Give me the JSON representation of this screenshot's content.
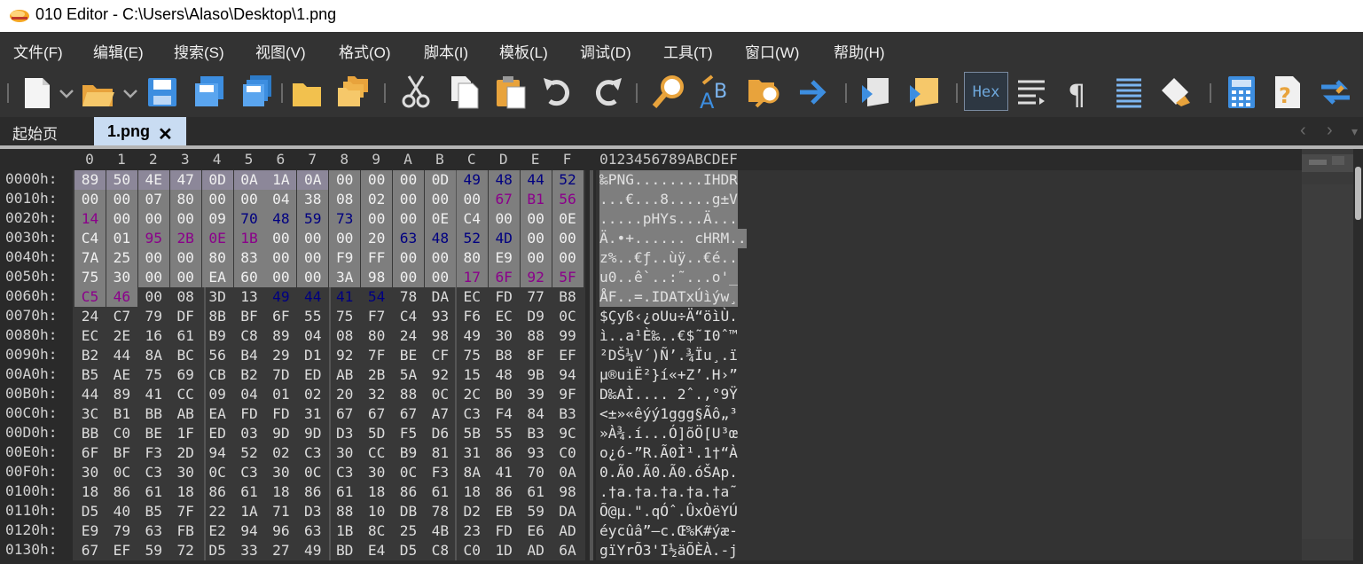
{
  "window": {
    "title": "010 Editor - C:\\Users\\Alaso\\Desktop\\1.png"
  },
  "menu": [
    "文件(F)",
    "编辑(E)",
    "搜索(S)",
    "视图(V)",
    "格式(O)",
    "脚本(I)",
    "模板(L)",
    "调试(D)",
    "工具(T)",
    "窗口(W)",
    "帮助(H)"
  ],
  "toolbar": {
    "hex_label": "Hex",
    "buttons": [
      "new-file-icon",
      "open-folder-icon",
      "save-icon",
      "save-as-icon",
      "save-all-icon",
      "open-folder2-icon",
      "folders-icon",
      "cut-icon",
      "copy-icon",
      "paste-icon",
      "undo-icon",
      "redo-icon",
      "find-icon",
      "replace-icon",
      "find-in-files-icon",
      "goto-icon",
      "run-script-icon",
      "run-template-icon",
      "hex-mode-button",
      "linewrap-icon",
      "pilcrow-icon",
      "columns-icon",
      "highlight-icon",
      "calculator-icon",
      "help-icon",
      "compare-icon"
    ]
  },
  "tabs": {
    "start": "起始页",
    "file": "1.png",
    "close": "✕"
  },
  "hex": {
    "columns": [
      "0",
      "1",
      "2",
      "3",
      "4",
      "5",
      "6",
      "7",
      "8",
      "9",
      "A",
      "B",
      "C",
      "D",
      "E",
      "F"
    ],
    "ascii_header": "0123456789ABCDEF",
    "rows": [
      {
        "addr": "0000h:",
        "bytes": [
          "89",
          "50",
          "4E",
          "47",
          "0D",
          "0A",
          "1A",
          "0A",
          "00",
          "00",
          "00",
          "0D",
          "49",
          "48",
          "44",
          "52"
        ],
        "ascii": "‰PNG........IHDR"
      },
      {
        "addr": "0010h:",
        "bytes": [
          "00",
          "00",
          "07",
          "80",
          "00",
          "00",
          "04",
          "38",
          "08",
          "02",
          "00",
          "00",
          "00",
          "67",
          "B1",
          "56"
        ],
        "ascii": "...€...8.....g±V"
      },
      {
        "addr": "0020h:",
        "bytes": [
          "14",
          "00",
          "00",
          "00",
          "09",
          "70",
          "48",
          "59",
          "73",
          "00",
          "00",
          "0E",
          "C4",
          "00",
          "00",
          "0E"
        ],
        "ascii": ".....pHYs...Ä..."
      },
      {
        "addr": "0030h:",
        "bytes": [
          "C4",
          "01",
          "95",
          "2B",
          "0E",
          "1B",
          "00",
          "00",
          "00",
          "20",
          "63",
          "48",
          "52",
          "4D",
          "00",
          "00"
        ],
        "ascii": "Ä.•+...... cHRM.."
      },
      {
        "addr": "0040h:",
        "bytes": [
          "7A",
          "25",
          "00",
          "00",
          "80",
          "83",
          "00",
          "00",
          "F9",
          "FF",
          "00",
          "00",
          "80",
          "E9",
          "00",
          "00"
        ],
        "ascii": "z%..€ƒ..ùÿ..€é.."
      },
      {
        "addr": "0050h:",
        "bytes": [
          "75",
          "30",
          "00",
          "00",
          "EA",
          "60",
          "00",
          "00",
          "3A",
          "98",
          "00",
          "00",
          "17",
          "6F",
          "92",
          "5F"
        ],
        "ascii": "u0..ê`..:˜...o'_"
      },
      {
        "addr": "0060h:",
        "bytes": [
          "C5",
          "46",
          "00",
          "08",
          "3D",
          "13",
          "49",
          "44",
          "41",
          "54",
          "78",
          "DA",
          "EC",
          "FD",
          "77",
          "B8"
        ],
        "ascii": "ÅF..=.IDATxÚìýw¸"
      },
      {
        "addr": "0070h:",
        "bytes": [
          "24",
          "C7",
          "79",
          "DF",
          "8B",
          "BF",
          "6F",
          "55",
          "75",
          "F7",
          "C4",
          "93",
          "F6",
          "EC",
          "D9",
          "0C"
        ],
        "ascii": "$Çyß‹¿oUu÷Ä“öìÙ."
      },
      {
        "addr": "0080h:",
        "bytes": [
          "EC",
          "2E",
          "16",
          "61",
          "B9",
          "C8",
          "89",
          "04",
          "08",
          "80",
          "24",
          "98",
          "49",
          "30",
          "88",
          "99"
        ],
        "ascii": "ì..a¹È‰..€$˜I0ˆ™"
      },
      {
        "addr": "0090h:",
        "bytes": [
          "B2",
          "44",
          "8A",
          "BC",
          "56",
          "B4",
          "29",
          "D1",
          "92",
          "7F",
          "BE",
          "CF",
          "75",
          "B8",
          "8F",
          "EF"
        ],
        "ascii": "²DŠ¼V´)Ñ’.¾Ïu¸.ï"
      },
      {
        "addr": "00A0h:",
        "bytes": [
          "B5",
          "AE",
          "75",
          "69",
          "CB",
          "B2",
          "7D",
          "ED",
          "AB",
          "2B",
          "5A",
          "92",
          "15",
          "48",
          "9B",
          "94"
        ],
        "ascii": "µ®uiË²}í«+Z’.H›”"
      },
      {
        "addr": "00B0h:",
        "bytes": [
          "44",
          "89",
          "41",
          "CC",
          "09",
          "04",
          "01",
          "02",
          "20",
          "32",
          "88",
          "0C",
          "2C",
          "B0",
          "39",
          "9F"
        ],
        "ascii": "D‰AÌ.... 2ˆ.,°9Ÿ"
      },
      {
        "addr": "00C0h:",
        "bytes": [
          "3C",
          "B1",
          "BB",
          "AB",
          "EA",
          "FD",
          "FD",
          "31",
          "67",
          "67",
          "67",
          "A7",
          "C3",
          "F4",
          "84",
          "B3"
        ],
        "ascii": "<±»«êýý1ggg§Ãô„³"
      },
      {
        "addr": "00D0h:",
        "bytes": [
          "BB",
          "C0",
          "BE",
          "1F",
          "ED",
          "03",
          "9D",
          "9D",
          "D3",
          "5D",
          "F5",
          "D6",
          "5B",
          "55",
          "B3",
          "9C"
        ],
        "ascii": "»À¾.í...Ó]õÖ[U³œ"
      },
      {
        "addr": "00E0h:",
        "bytes": [
          "6F",
          "BF",
          "F3",
          "2D",
          "94",
          "52",
          "02",
          "C3",
          "30",
          "CC",
          "B9",
          "81",
          "31",
          "86",
          "93",
          "C0"
        ],
        "ascii": "o¿ó-”R.Ã0Ì¹.1†“À"
      },
      {
        "addr": "00F0h:",
        "bytes": [
          "30",
          "0C",
          "C3",
          "30",
          "0C",
          "C3",
          "30",
          "0C",
          "C3",
          "30",
          "0C",
          "F3",
          "8A",
          "41",
          "70",
          "0A"
        ],
        "ascii": "0.Ã0.Ã0.Ã0.óŠAp."
      },
      {
        "addr": "0100h:",
        "bytes": [
          "18",
          "86",
          "61",
          "18",
          "86",
          "61",
          "18",
          "86",
          "61",
          "18",
          "86",
          "61",
          "18",
          "86",
          "61",
          "98"
        ],
        "ascii": ".†a.†a.†a.†a.†a˜"
      },
      {
        "addr": "0110h:",
        "bytes": [
          "D5",
          "40",
          "B5",
          "7F",
          "22",
          "1A",
          "71",
          "D3",
          "88",
          "10",
          "DB",
          "78",
          "D2",
          "EB",
          "59",
          "DA"
        ],
        "ascii": "Õ@µ.\".qÓˆ.ÛxÒëYÚ"
      },
      {
        "addr": "0120h:",
        "bytes": [
          "E9",
          "79",
          "63",
          "FB",
          "E2",
          "94",
          "96",
          "63",
          "1B",
          "8C",
          "25",
          "4B",
          "23",
          "FD",
          "E6",
          "AD"
        ],
        "ascii": "éycûâ”–c.Œ%K#ýæ-"
      },
      {
        "addr": "0130h:",
        "bytes": [
          "67",
          "EF",
          "59",
          "72",
          "D5",
          "33",
          "27",
          "49",
          "BD",
          "E4",
          "D5",
          "C8",
          "C0",
          "1D",
          "AD",
          "6A"
        ],
        "ascii": "gïYrÕ3'I½äÕÈÀ.-j"
      }
    ]
  }
}
